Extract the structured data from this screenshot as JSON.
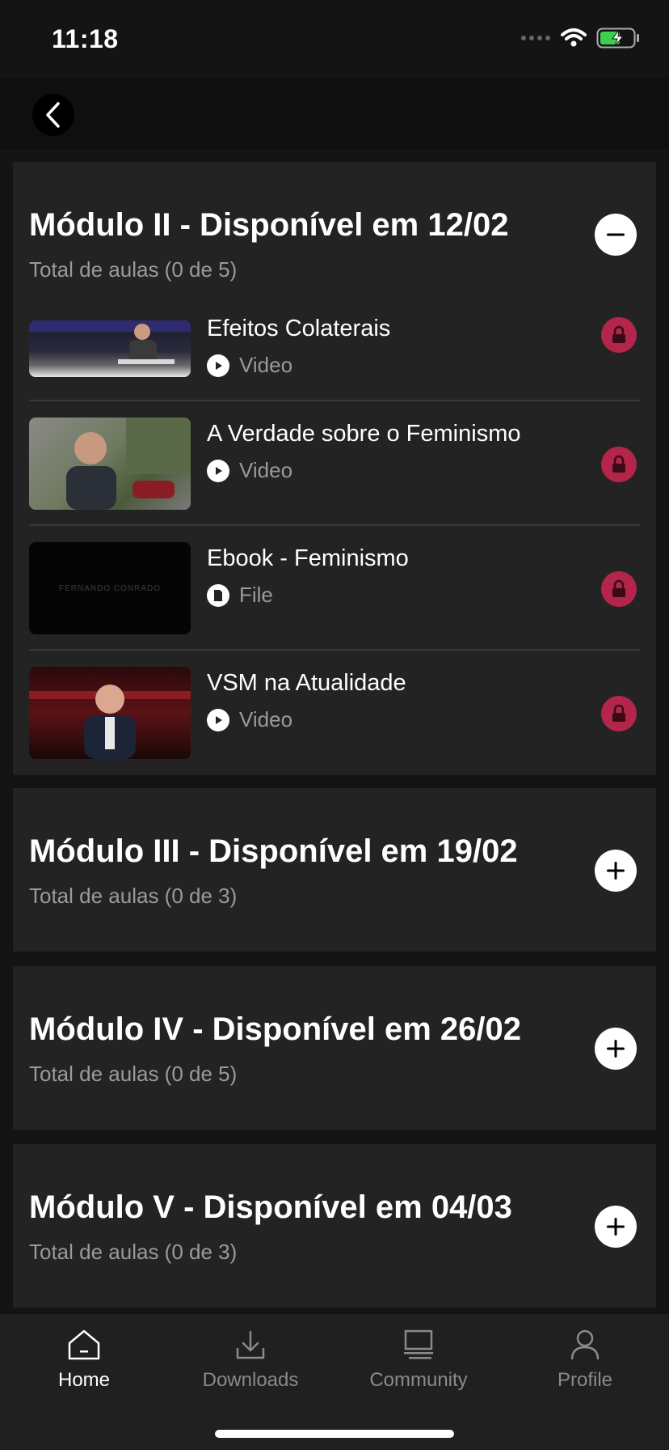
{
  "status": {
    "time": "11:18"
  },
  "modules": [
    {
      "title": "Módulo II - Disponível em 12/02",
      "subtitle": "Total de aulas (0 de 5)",
      "expanded": true,
      "lessons": [
        {
          "title": "Efeitos Colaterais",
          "type": "Video",
          "thumb_text": ""
        },
        {
          "title": "A Verdade sobre o Feminismo",
          "type": "Video",
          "thumb_text": ""
        },
        {
          "title": "Ebook - Feminismo",
          "type": "File",
          "thumb_text": "FERNANDO CONRADO"
        },
        {
          "title": "VSM na Atualidade",
          "type": "Video",
          "thumb_text": ""
        }
      ]
    },
    {
      "title": "Módulo III - Disponível em 19/02",
      "subtitle": "Total de aulas (0 de 3)",
      "expanded": false
    },
    {
      "title": "Módulo IV - Disponível em 26/02",
      "subtitle": "Total de aulas (0 de 5)",
      "expanded": false
    },
    {
      "title": "Módulo V - Disponível em 04/03",
      "subtitle": "Total de aulas (0 de 3)",
      "expanded": false
    }
  ],
  "tabs": [
    {
      "label": "Home",
      "icon": "home-icon",
      "active": true
    },
    {
      "label": "Downloads",
      "icon": "download-icon",
      "active": false
    },
    {
      "label": "Community",
      "icon": "community-icon",
      "active": false
    },
    {
      "label": "Profile",
      "icon": "profile-icon",
      "active": false
    }
  ],
  "colors": {
    "lock": "#b3254a",
    "card": "#232323",
    "background": "#141414"
  }
}
